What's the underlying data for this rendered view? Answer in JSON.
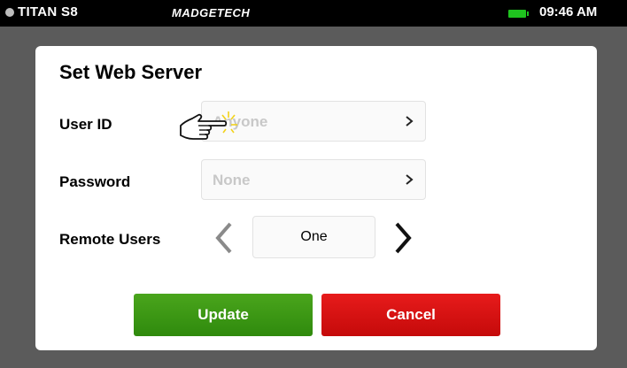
{
  "status_bar": {
    "device_name": "TITAN S8",
    "brand": "MADGETECH",
    "time": "09:46 AM",
    "battery_color": "#1fc31f"
  },
  "dialog": {
    "title": "Set Web Server",
    "user_id": {
      "label": "User ID",
      "value": "Anyone"
    },
    "password": {
      "label": "Password",
      "value": "None"
    },
    "remote_users": {
      "label": "Remote Users",
      "value": "One"
    },
    "update_label": "Update",
    "cancel_label": "Cancel"
  },
  "colors": {
    "update": "#3c9a15",
    "cancel": "#d61010"
  },
  "icons": {
    "pointer": "tap-hand-icon"
  }
}
